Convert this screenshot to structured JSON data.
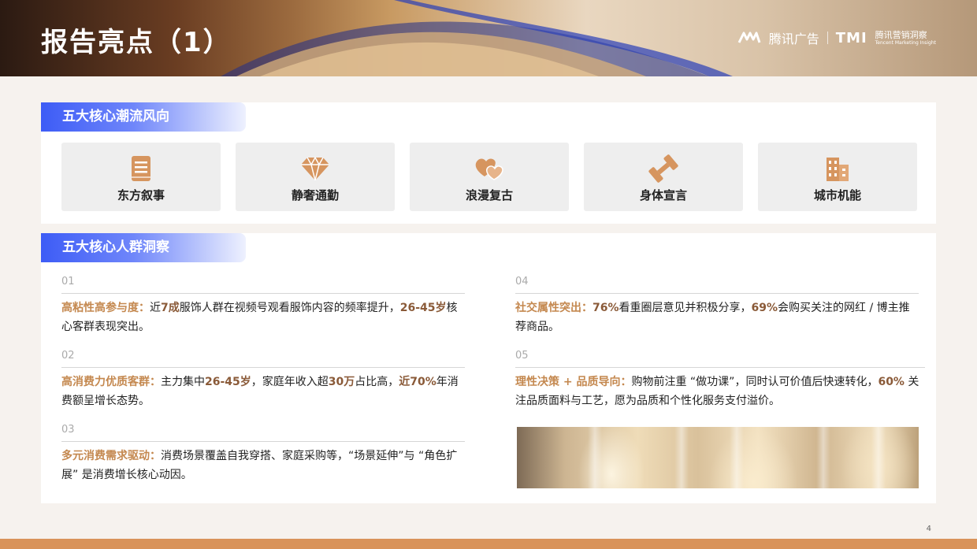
{
  "header": {
    "title": "报告亮点（1）",
    "brand_tencent": "腾讯广告",
    "brand_tmi": "TMI",
    "brand_tmi_cn": "腾讯营销洞察",
    "brand_tmi_en": "Tencent Marketing Insight"
  },
  "trends": {
    "section_title": "五大核心潮流风向",
    "items": [
      {
        "label": "东方叙事",
        "icon": "book-icon"
      },
      {
        "label": "静奢通勤",
        "icon": "diamond-icon"
      },
      {
        "label": "浪漫复古",
        "icon": "hearts-icon"
      },
      {
        "label": "身体宣言",
        "icon": "dumbbell-icon"
      },
      {
        "label": "城市机能",
        "icon": "building-icon"
      }
    ]
  },
  "insights": {
    "section_title": "五大核心人群洞察",
    "items": [
      {
        "num": "01",
        "lead": "高粘性高参与度：",
        "parts": [
          "近",
          "7成",
          "服饰人群在视频号观看服饰内容的频率提升，",
          "26-45岁",
          "核心客群表现突出。"
        ]
      },
      {
        "num": "02",
        "lead": "高消费力优质客群：",
        "parts": [
          "主力集中",
          "26-45岁",
          "，家庭年收入超",
          "30万",
          "占比高，",
          "近70%",
          "年消费额呈增长态势。"
        ]
      },
      {
        "num": "03",
        "lead": "多元消费需求驱动：",
        "parts": [
          "消费场景覆盖自我穿搭、家庭采购等，",
          "“场景延伸”与 “角色扩展” 是消费增长核心动因。"
        ]
      },
      {
        "num": "04",
        "lead": "社交属性突出：",
        "parts": [
          "76%",
          "看重圈层意见并积极分享，",
          "69%",
          "会购买关注的网红 / 博主推荐商品。"
        ]
      },
      {
        "num": "05",
        "lead": "理性决策 + 品质导向：",
        "parts": [
          "购物前注重 “做功课”，同时认可价值后快速转化，",
          "60%",
          " 关注品质面料与工艺，愿为品质和个性化服务支付溢价。"
        ]
      }
    ]
  },
  "colors": {
    "accent_blue": "#3d5cf6",
    "lead_gold": "#c4884f",
    "highlight_brown": "#8a5a38",
    "icon_tan": "#d6955f",
    "footer": "#d9935a"
  },
  "page": {
    "number": "4"
  }
}
